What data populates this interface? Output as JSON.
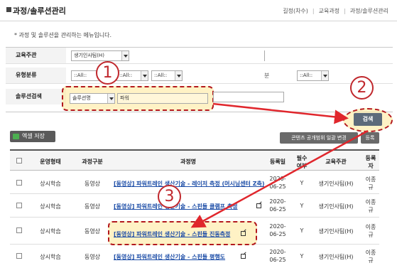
{
  "header": {
    "title": "과정/솔루션관리",
    "breadcrumb": [
      "길정(차수)",
      "교육과정",
      "과정/솔루션관리"
    ]
  },
  "description": "* 과정 및 솔루션을 관리하는 메뉴입니다.",
  "form": {
    "org_label": "교육주관",
    "org_value": "생기인사팀(H)",
    "type_label": "유형분류",
    "type_sel1": "::All::",
    "type_sel2": "::All::",
    "type_sel3": "::All::",
    "type_extra_label": "분",
    "type_sel4": "::All::",
    "solution_label": "솔루션검색",
    "solution_field": "솔루션명",
    "solution_keyword": "파워"
  },
  "annotations": {
    "n1": "1",
    "n2": "2",
    "n3": "3",
    "accent": "#c0282d"
  },
  "buttons": {
    "search": "검색",
    "excel": "엑셀 저장",
    "public": "콘텐츠 공개범위 일괄 변경",
    "register": "등록"
  },
  "table": {
    "headers": {
      "type": "운영형태",
      "category": "과정구분",
      "name": "과정명",
      "date": "등록일",
      "required_1": "필수",
      "required_2": "여부",
      "org": "교육주관",
      "author_1": "등록",
      "author_2": "자"
    },
    "rows": [
      {
        "type": "상시학습",
        "category": "동영상",
        "name": "[동영상] 파워트레인 생산기술 - 레이저 측정 (머시닝센터 Z축)",
        "date_1": "2020-",
        "date_2": "06-25",
        "req": "Y",
        "org": "생기인사팀(H)",
        "author_1": "이종",
        "author_2": "규"
      },
      {
        "type": "상시학습",
        "category": "동영상",
        "name": "[동영상] 파워트레인 생산기술 - 스핀들 클램프 측정",
        "date_1": "2020-",
        "date_2": "06-25",
        "req": "Y",
        "org": "생기인사팀(H)",
        "author_1": "이종",
        "author_2": "규"
      },
      {
        "type": "상시학습",
        "category": "동영상",
        "name": "[동영상] 파워트레인 생산기술 - 스핀들 진동측정",
        "date_1": "2020-",
        "date_2": "06-25",
        "req": "Y",
        "org": "생기인사팀(H)",
        "author_1": "이종",
        "author_2": "규"
      },
      {
        "type": "상시학습",
        "category": "동영상",
        "name": "[동영상] 파워트레인 생산기술 - 스핀들 평행도",
        "date_1": "2020-",
        "date_2": "06-25",
        "req": "Y",
        "org": "생기인사팀(H)",
        "author_1": "이종",
        "author_2": "규"
      }
    ]
  }
}
